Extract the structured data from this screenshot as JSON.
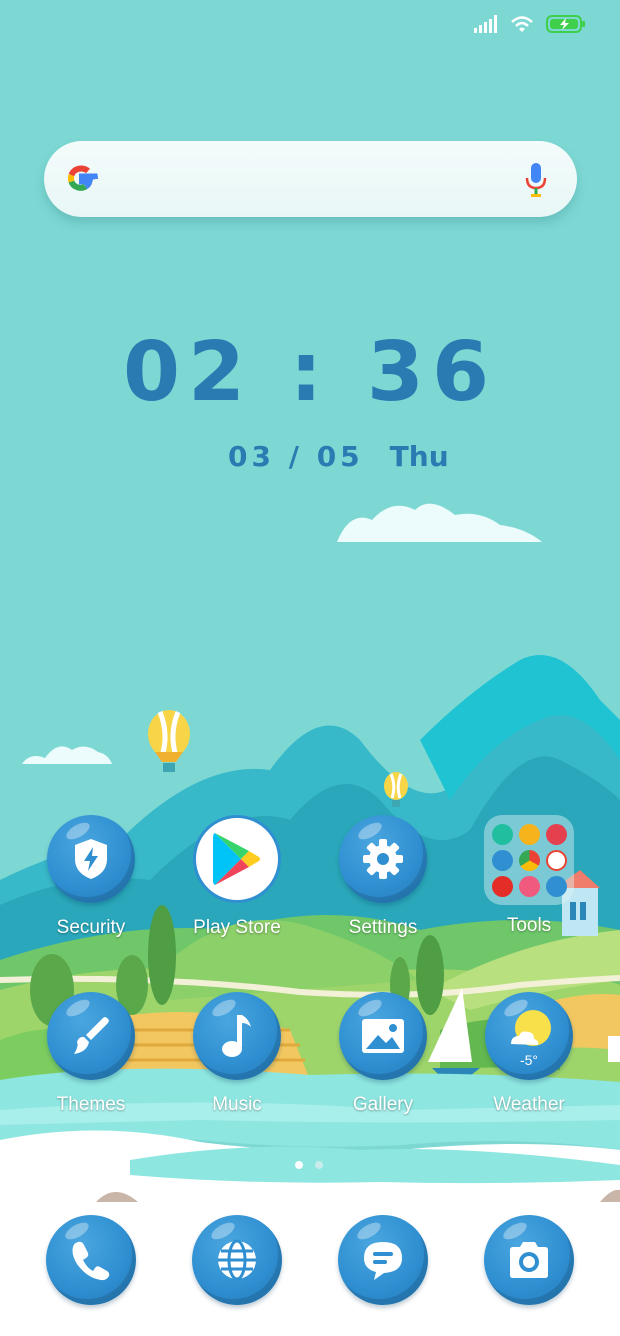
{
  "status_bar": {
    "signal_icon": "signal-icon",
    "wifi_icon": "wifi-icon",
    "battery_icon": "battery-charging-icon",
    "battery_color": "#3fcf4a"
  },
  "search": {
    "logo": "google-logo",
    "mic_icon": "mic-icon"
  },
  "clock": {
    "time": "02 : 36",
    "date": "03 / 05",
    "day": "Thu"
  },
  "home_row_1": [
    {
      "label": "Security",
      "icon": "shield-bolt-icon"
    },
    {
      "label": "Play Store",
      "icon": "play-store-icon"
    },
    {
      "label": "Settings",
      "icon": "gear-icon"
    },
    {
      "label": "Tools",
      "icon": "folder-icon"
    }
  ],
  "home_row_2": [
    {
      "label": "Themes",
      "icon": "paintbrush-icon"
    },
    {
      "label": "Music",
      "icon": "music-note-icon"
    },
    {
      "label": "Gallery",
      "icon": "image-icon"
    },
    {
      "label": "Weather",
      "icon": "weather-sun-cloud-icon",
      "temp": "-5°"
    }
  ],
  "page_indicator": {
    "pages": 2,
    "active": 1
  },
  "dock": [
    {
      "icon": "phone-icon"
    },
    {
      "icon": "browser-globe-icon"
    },
    {
      "icon": "messages-icon"
    },
    {
      "icon": "camera-icon"
    }
  ],
  "colors": {
    "sky": "#7dd8d4",
    "accent_blue": "#2f8fd1",
    "clock_text": "#2a7bb2"
  }
}
